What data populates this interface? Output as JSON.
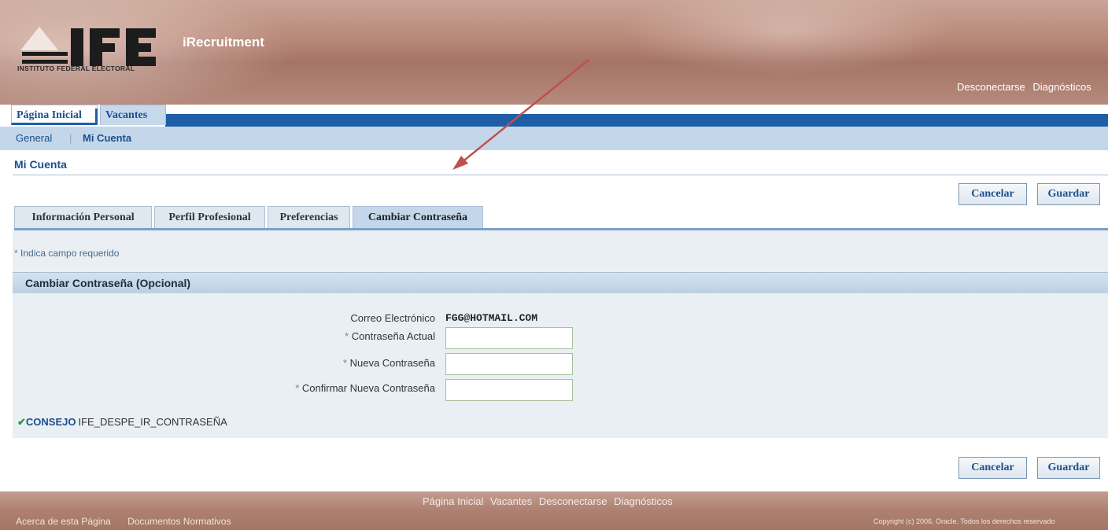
{
  "header": {
    "org_name": "INSTITUTO FEDERAL ELECTORAL",
    "logo_text": "IFE",
    "app_title": "iRecruitment",
    "global_links": [
      "Desconectarse",
      "Diagnósticos"
    ]
  },
  "tabs": [
    {
      "label": "Página Inicial",
      "active": true
    },
    {
      "label": "Vacantes",
      "active": false
    }
  ],
  "subnav": {
    "general": "General",
    "separator": "|",
    "mi_cuenta": "Mi Cuenta"
  },
  "page_title": "Mi Cuenta",
  "buttons": {
    "cancel": "Cancelar",
    "save": "Guardar"
  },
  "subtabs": [
    {
      "label": "Información Personal",
      "active": false
    },
    {
      "label": "Perfil Profesional",
      "active": false
    },
    {
      "label": "Preferencias",
      "active": false
    },
    {
      "label": "Cambiar Contraseña",
      "active": true
    }
  ],
  "required_note": "Indica campo requerido",
  "required_star": "*",
  "section_title": "Cambiar Contraseña (Opcional)",
  "form": {
    "email_label": "Correo Electrónico",
    "email_value": "FGG@HOTMAIL.COM",
    "current_pw_label": "Contraseña Actual",
    "new_pw_label": "Nueva Contraseña",
    "confirm_pw_label": "Confirmar Nueva Contraseña",
    "current_pw_value": "",
    "new_pw_value": "",
    "confirm_pw_value": ""
  },
  "tip": {
    "label": "CONSEJO",
    "text": "IFE_DESPE_IR_CONTRASEÑA"
  },
  "footer": {
    "links": [
      "Página Inicial",
      "Vacantes",
      "Desconectarse",
      "Diagnósticos"
    ],
    "left_links": [
      "Acerca de esta Página",
      "Documentos Normativos"
    ],
    "copyright": "Copyright (c) 2006, Oracle. Todos los derechos reservado"
  },
  "colors": {
    "accent": "#1e5ea6",
    "link": "#1b4f8c",
    "annotation_arrow": "#c0504d"
  }
}
